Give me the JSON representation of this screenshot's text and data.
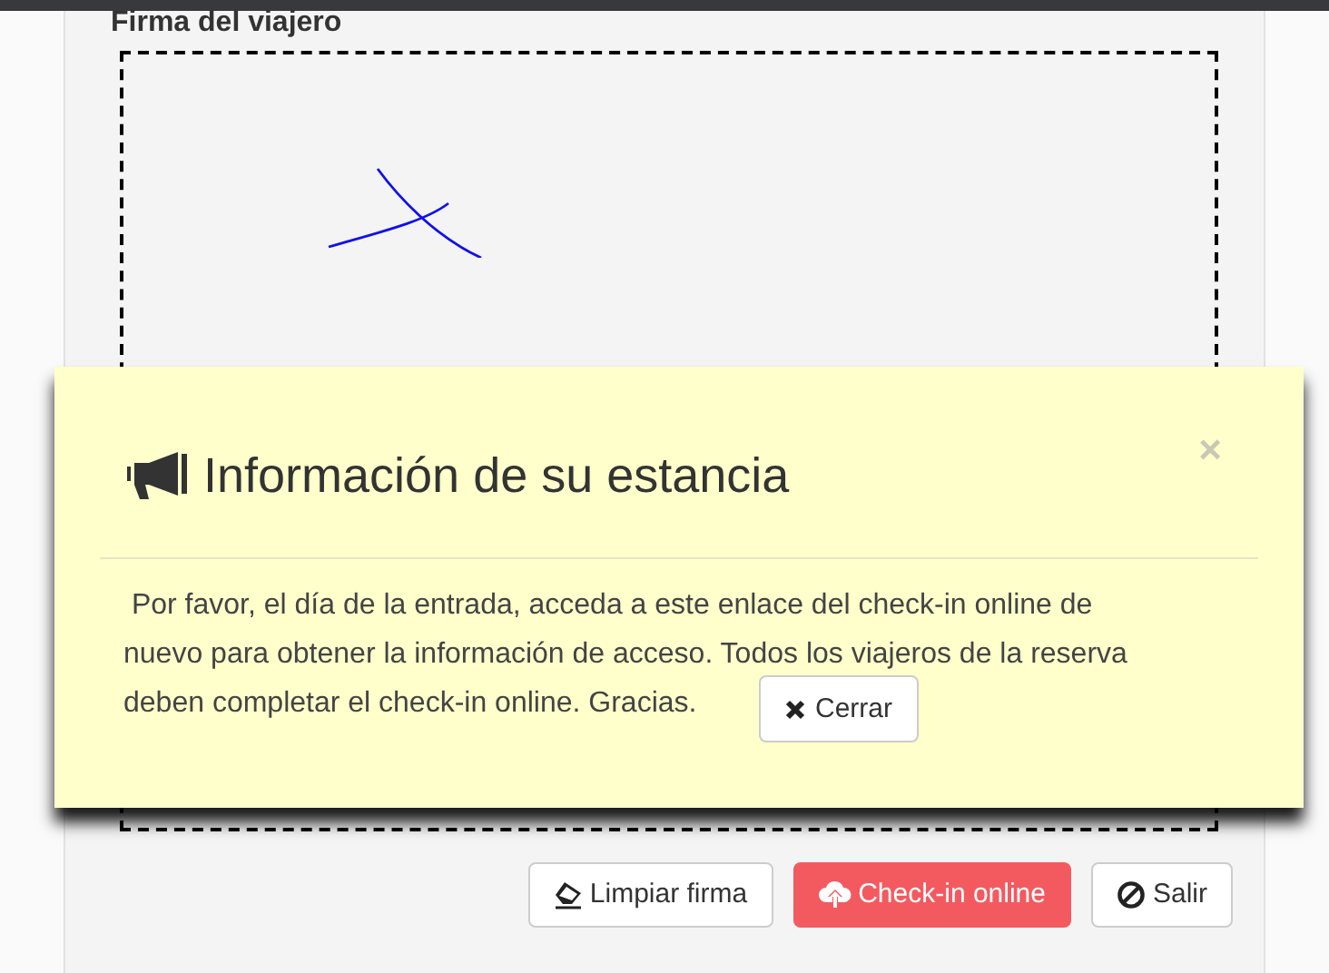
{
  "signature": {
    "label": "Firma del viajero"
  },
  "modal": {
    "title": "Información de su estancia",
    "close": "×",
    "message_lines": [
      " Por favor, el día de la entrada, acceda a este enlace del check-in online de",
      "nuevo para obtener la información de acceso. Todos los viajeros de la reserva",
      "deben completar el check-in online. Gracias."
    ],
    "button": "Cerrar"
  },
  "buttons": [
    {
      "label": "Limpiar firma",
      "kind": "eraser"
    },
    {
      "label": "Check-in online",
      "kind": "upload"
    },
    {
      "label": "Salir",
      "kind": "ban"
    }
  ]
}
